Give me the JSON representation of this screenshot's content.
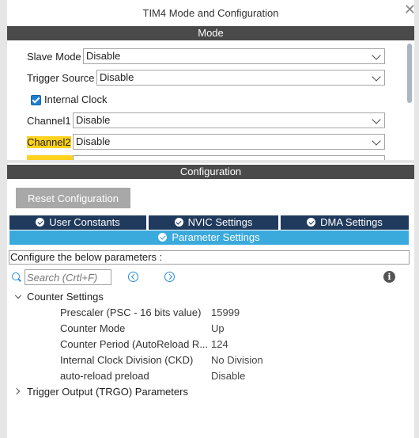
{
  "window": {
    "title": "TIM4 Mode and Configuration",
    "close_glyph": "✕"
  },
  "mode": {
    "section_label": "Mode",
    "slave_mode": {
      "label": "Slave Mode",
      "value": "Disable"
    },
    "trigger_source": {
      "label": "Trigger Source",
      "value": "Disable"
    },
    "internal_clock": {
      "label": "Internal Clock",
      "checked": true
    },
    "channel1": {
      "label": "Channel1",
      "value": "Disable"
    },
    "channel2": {
      "label": "Channel2",
      "value": "Disable"
    }
  },
  "configuration": {
    "section_label": "Configuration",
    "reset_button": "Reset Configuration",
    "tabs": [
      {
        "label": "User Constants"
      },
      {
        "label": "NVIC Settings"
      },
      {
        "label": "DMA Settings"
      }
    ],
    "active_tab": {
      "label": "Parameter Settings"
    },
    "description": "Configure the below parameters :",
    "search": {
      "placeholder": "Search (Crtl+F)"
    },
    "groups": [
      {
        "label": "Counter Settings",
        "expanded": true,
        "params": [
          {
            "name": "Prescaler (PSC - 16 bits value)",
            "value": "15999"
          },
          {
            "name": "Counter Mode",
            "value": "Up"
          },
          {
            "name": "Counter Period (AutoReload R...",
            "value": "124"
          },
          {
            "name": "Internal Clock Division (CKD)",
            "value": "No Division"
          },
          {
            "name": "auto-reload preload",
            "value": "Disable"
          }
        ]
      },
      {
        "label": "Trigger Output (TRGO) Parameters",
        "expanded": false
      }
    ]
  },
  "colors": {
    "section_bar": "#4a4a4a",
    "tab_dark": "#1f3a5c",
    "tab_active": "#3aa9dc",
    "highlight": "#ffd21e",
    "accent_blue": "#2a8bd6"
  }
}
